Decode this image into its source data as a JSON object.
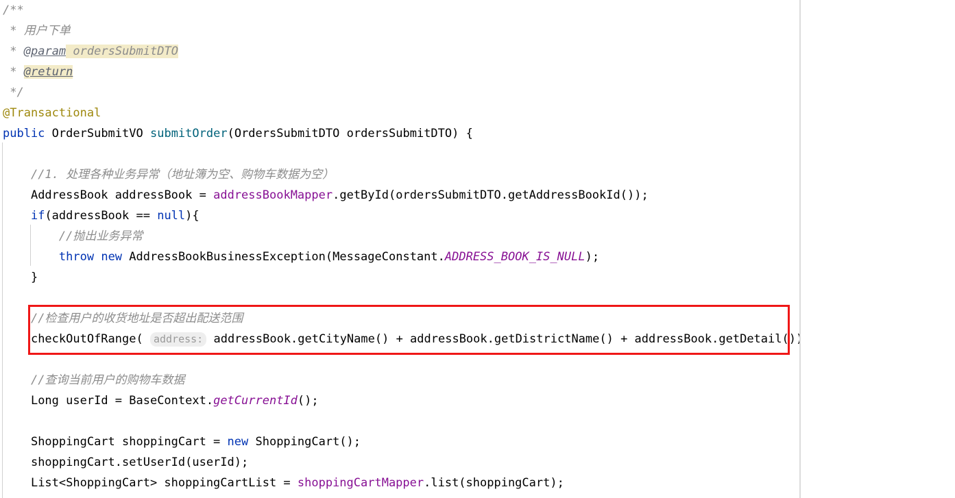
{
  "editor": {
    "language": "Java",
    "font_size_px": 17,
    "line_height_px": 30,
    "background": "#ffffff",
    "divider_color": "#dcdcdc"
  },
  "colors": {
    "keyword": "#0033b3",
    "method_declaration": "#00627a",
    "instance_field": "#871094",
    "static_field": "#871094",
    "annotation": "#9e880d",
    "comment": "#8c8c8c",
    "javadoc_tag": "#5d6370",
    "javadoc_highlight_bg": "#f3ebc8",
    "inlay_hint_bg": "#eeeeee",
    "inlay_hint_text": "#9a9a9a",
    "annotation_box_border": "#ef1717",
    "indent_guide": "#d0d0d0"
  },
  "javadoc": {
    "open": "/**",
    "star": "*",
    "description": "用户下单",
    "param_tag": "@param",
    "param_name": "ordersSubmitDTO",
    "return_tag": "@return",
    "close": "*/"
  },
  "annotation": {
    "transactional": "@Transactional"
  },
  "signature": {
    "modifier": "public",
    "return_type": "OrderSubmitVO",
    "name": "submitOrder",
    "open_paren": "(",
    "param_type": "OrdersSubmitDTO",
    "param_name": "ordersSubmitDTO",
    "close_paren": ")",
    "brace": "{"
  },
  "body": {
    "comment_step1": "//1. 处理各种业务异常（地址簿为空、购物车数据为空）",
    "line_addressbook": {
      "type": "AddressBook",
      "var": "addressBook",
      "eq": " = ",
      "field": "addressBookMapper",
      "call": ".getById(ordersSubmitDTO.getAddressBookId());"
    },
    "line_if": {
      "kw": "if",
      "open": "(addressBook == ",
      "null_kw": "null",
      "close": "){"
    },
    "comment_throw": "//抛出业务异常",
    "line_throw": {
      "throw_kw": "throw",
      "new_kw": "new",
      "exception": "AddressBookBusinessException(MessageConstant.",
      "constant": "ADDRESS_BOOK_IS_NULL",
      "tail": ");"
    },
    "close_brace": "}",
    "comment_range": "//检查用户的收货地址是否超出配送范围",
    "line_checkrange": {
      "call": "checkOutOfRange(",
      "inlay_hint": "address:",
      "arg": "addressBook.getCityName() + addressBook.getDistrictName() + addressBook.getDetail());"
    },
    "comment_cart": "//查询当前用户的购物车数据",
    "line_userid": {
      "type": "Long",
      "var": " userId = BaseContext.",
      "static_call": "getCurrentId",
      "tail": "();"
    },
    "line_newcart": {
      "head": "ShoppingCart shoppingCart = ",
      "new_kw": "new",
      "tail": " ShoppingCart();"
    },
    "line_setuser": "shoppingCart.setUserId(userId);",
    "line_list": {
      "head": "List<ShoppingCart> shoppingCartList = ",
      "field": "shoppingCartMapper",
      "tail": ".list(shoppingCart);"
    }
  },
  "annotations_overlay": {
    "red_box_label": "checkOutOfRange-call-highlight"
  }
}
